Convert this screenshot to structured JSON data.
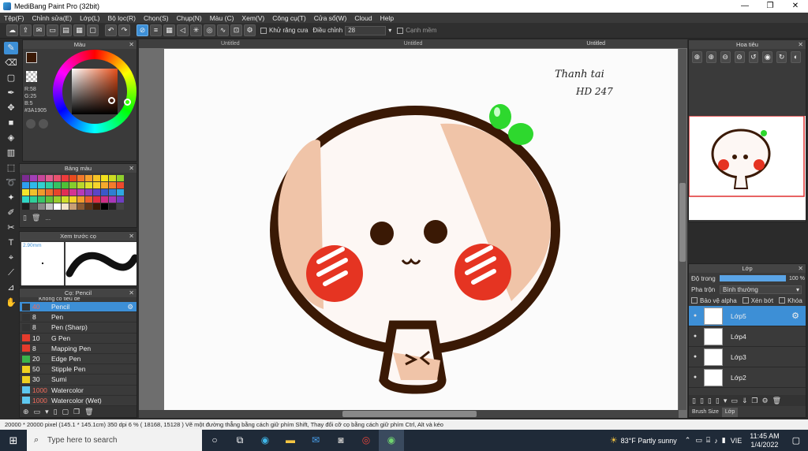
{
  "window": {
    "title": "MediBang Paint Pro (32bit)",
    "min": "—",
    "max": "❐",
    "close": "✕"
  },
  "menu": [
    "Tệp(F)",
    "Chỉnh sửa(E)",
    "Lớp(L)",
    "Bộ lọc(R)",
    "Chọn(S)",
    "Chụp(N)",
    "Màu (C)",
    "Xem(V)",
    "Công cụ(T)",
    "Cửa sổ(W)",
    "Cloud",
    "Help"
  ],
  "toolbar": {
    "antialias_label": "Khử răng cưa",
    "adjust_label": "Điều chỉnh",
    "adjust_value": "28",
    "edge_label": "Cạnh mềm"
  },
  "color_panel": {
    "title": "Màu",
    "r": "R:58",
    "g": "G:25",
    "b": "B:5",
    "hex": "#3A1905",
    "primary": "#3a1905",
    "secondary": "#d93a1c"
  },
  "swatch_panel": {
    "title": "Bảng màu",
    "ellipsis": "...",
    "colors": [
      "#7c2b91",
      "#a23fb7",
      "#c7469a",
      "#e15c8e",
      "#e9526f",
      "#ef3b3b",
      "#e84b1e",
      "#f2792a",
      "#f7a12c",
      "#f6c425",
      "#f3e21c",
      "#cbdc22",
      "#8fcf2d",
      "#2e9ef0",
      "#2fb9e9",
      "#31d0cf",
      "#2fcf9e",
      "#36c262",
      "#4fbf37",
      "#86cd2d",
      "#b9d72b",
      "#dfe22b",
      "#f5d52b",
      "#f6aa2c",
      "#f47b2c",
      "#ee4a2c",
      "#f5e52b",
      "#f1c12c",
      "#ef9a2c",
      "#ec6f2c",
      "#e8442b",
      "#e12e55",
      "#d43492",
      "#b73bb7",
      "#8a3fc0",
      "#5b45c6",
      "#3a59c8",
      "#2e7fd2",
      "#2ea8e2",
      "#2fd5c5",
      "#2fd09a",
      "#38c569",
      "#62c13a",
      "#9bcd2d",
      "#d0dd2a",
      "#f4d12b",
      "#f19c2c",
      "#ec5e2c",
      "#e12d43",
      "#cf2f86",
      "#a937b8",
      "#6e3fc3",
      "#1e1e1e",
      "#555555",
      "#8a8a8a",
      "#c4c4c4",
      "#ffffff",
      "#f3e3c8",
      "#c89f76",
      "#8a5a33",
      "#5a3419",
      "#3a1905",
      "#000000",
      "#222222",
      "#444444"
    ]
  },
  "brush_preview": {
    "title": "Xem trước cọ",
    "size": "2.90mm"
  },
  "brush_panel": {
    "title": "Cọ: Pencil",
    "partial_top": "Không có tiêu đề",
    "brushes": [
      {
        "size": "40",
        "name": "Pencil",
        "color": "#333333",
        "selected": true
      },
      {
        "size": "8",
        "name": "Pen",
        "color": "#333333"
      },
      {
        "size": "8",
        "name": "Pen (Sharp)",
        "color": "#333333"
      },
      {
        "size": "10",
        "name": "G Pen",
        "color": "#e53b2c"
      },
      {
        "size": "8",
        "name": "Mapping Pen",
        "color": "#e53b2c"
      },
      {
        "size": "20",
        "name": "Edge Pen",
        "color": "#3bb34a"
      },
      {
        "size": "50",
        "name": "Stipple Pen",
        "color": "#f0d020"
      },
      {
        "size": "30",
        "name": "Sumi",
        "color": "#f0d020"
      },
      {
        "size": "1000",
        "name": "Watercolor",
        "color": "#5ec8f0"
      },
      {
        "size": "1000",
        "name": "Watercolor (Wet)",
        "color": "#5ec8f0"
      }
    ]
  },
  "canvas_tabs": [
    "Untitled",
    "Untitled",
    "Untitled"
  ],
  "artwork": {
    "sig_line1": "Thanh tai",
    "sig_line2": "HD 247"
  },
  "navigator": {
    "title": "Hoa tiêu"
  },
  "layers": {
    "title": "Lớp",
    "opacity_label": "Độ trong",
    "opacity_value": "100 %",
    "opacity": 1.0,
    "blend_label": "Pha trộn",
    "blend_value": "Bình thường",
    "protect_alpha": "Bảo vệ alpha",
    "clipping": "Xén bớt",
    "lock": "Khóa",
    "items": [
      {
        "name": "Lớp5",
        "selected": true
      },
      {
        "name": "Lớp4"
      },
      {
        "name": "Lớp3"
      },
      {
        "name": "Lớp2"
      }
    ],
    "bottom_tabs": [
      "Brush Size",
      "Lớp"
    ]
  },
  "status": "20000 * 20000 pixel   (145.1 * 145.1cm)   350 dpi   6 %   ( 18168, 15128 )   Vẽ một đường thẳng bằng cách giữ phím Shift, Thay đổi cỡ cọ bằng cách giữ phím Ctrl, Alt và kéo",
  "taskbar": {
    "search_placeholder": "Type here to search",
    "weather": "83°F  Partly sunny",
    "lang": "VIE",
    "time": "11:45 AM",
    "date": "1/4/2022"
  }
}
